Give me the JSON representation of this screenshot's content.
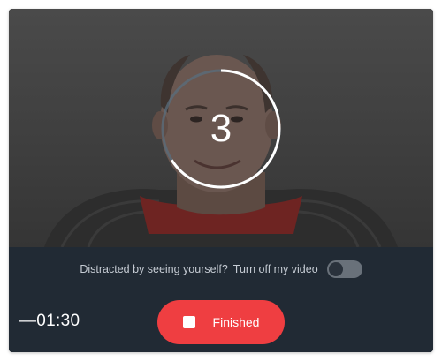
{
  "recorder": {
    "countdown": {
      "value": "3",
      "progress": 0.66
    },
    "self_view": {
      "prompt": "Distracted by seeing yourself?",
      "toggle_label": "Turn off my video",
      "toggle_on": false
    },
    "timer": "—01:30",
    "finish_button": {
      "label": "Finished",
      "icon": "stop-icon"
    },
    "colors": {
      "accent": "#ef3e41",
      "panel": "#212a34",
      "toggle_track": "#69717a"
    }
  }
}
